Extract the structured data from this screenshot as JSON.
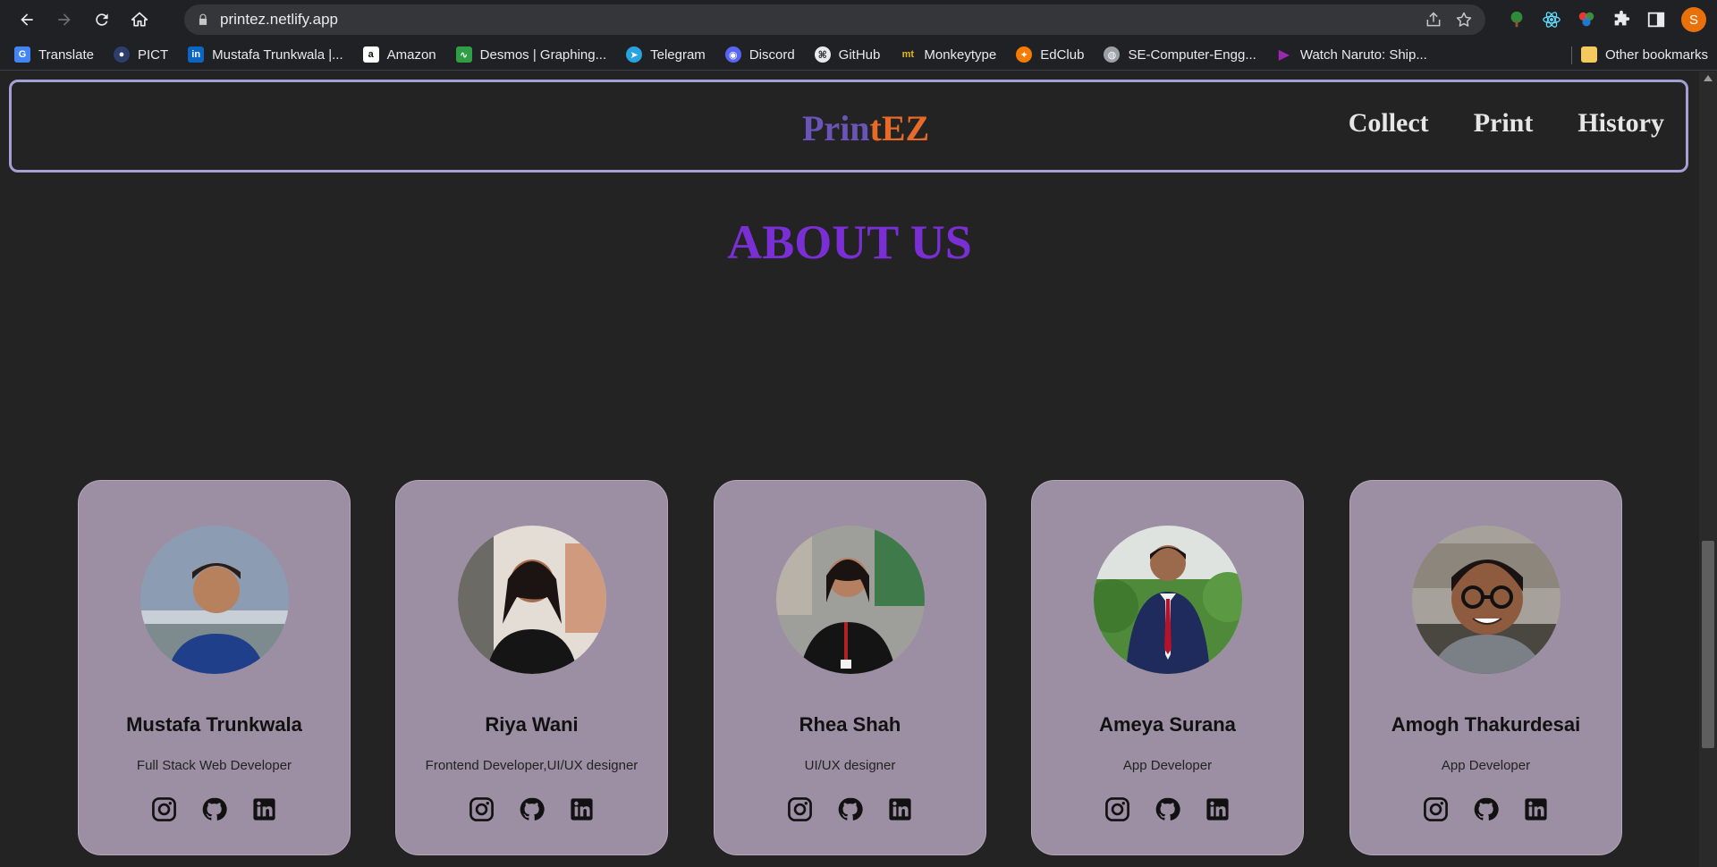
{
  "browser": {
    "url": "printez.netlify.app",
    "profile_initial": "S",
    "bookmarks": [
      {
        "label": "Translate",
        "icon": "translate-icon"
      },
      {
        "label": "PICT",
        "icon": "pict-icon"
      },
      {
        "label": "Mustafa Trunkwala |...",
        "icon": "linkedin-icon"
      },
      {
        "label": "Amazon",
        "icon": "amazon-icon"
      },
      {
        "label": "Desmos | Graphing...",
        "icon": "desmos-icon"
      },
      {
        "label": "Telegram",
        "icon": "telegram-icon"
      },
      {
        "label": "Discord",
        "icon": "discord-icon"
      },
      {
        "label": "GitHub",
        "icon": "github-icon"
      },
      {
        "label": "Monkeytype",
        "icon": "monkeytype-icon"
      },
      {
        "label": "EdClub",
        "icon": "edclub-icon"
      },
      {
        "label": "SE-Computer-Engg...",
        "icon": "globe-icon"
      },
      {
        "label": "Watch Naruto: Ship...",
        "icon": "play-icon"
      }
    ],
    "other_bookmarks": "Other bookmarks"
  },
  "site": {
    "logo_part1": "Prin",
    "logo_part2": "tEZ",
    "nav": [
      "Collect",
      "Print",
      "History"
    ],
    "about_title": "ABOUT US"
  },
  "team": [
    {
      "name": "Mustafa Trunkwala",
      "role": "Full Stack Web Developer"
    },
    {
      "name": "Riya Wani",
      "role": "Frontend Developer,UI/UX designer"
    },
    {
      "name": "Rhea Shah",
      "role": "UI/UX designer"
    },
    {
      "name": "Ameya Surana",
      "role": "App Developer"
    },
    {
      "name": "Amogh Thakurdesai",
      "role": "App Developer"
    }
  ],
  "colors": {
    "logo_purple": "#6a54b8",
    "logo_orange": "#e76a26",
    "about_title": "#7a2fd4",
    "card_bg": "#9c8fa3",
    "nav_border": "#a69fd6"
  }
}
